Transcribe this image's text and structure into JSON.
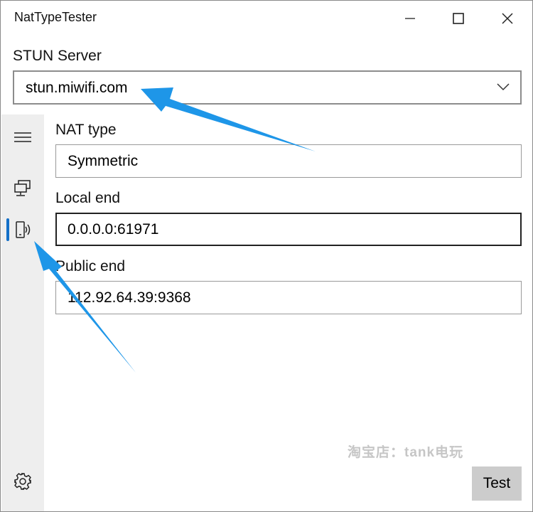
{
  "window": {
    "title": "NatTypeTester"
  },
  "stun": {
    "label": "STUN Server",
    "value": "stun.miwifi.com"
  },
  "nav": {
    "items": [
      {
        "icon": "hamburger-menu-icon",
        "selected": false
      },
      {
        "icon": "computer-network-icon",
        "selected": false
      },
      {
        "icon": "device-signal-icon",
        "selected": true
      },
      {
        "icon": "gear-icon",
        "selected": false
      }
    ],
    "accent_color": "#1470c8"
  },
  "fields": {
    "nat_type": {
      "label": "NAT type",
      "value": "Symmetric"
    },
    "local_end": {
      "label": "Local end",
      "value": "0.0.0.0:61971"
    },
    "public_end": {
      "label": "Public end",
      "value": "112.92.64.39:9368"
    }
  },
  "actions": {
    "test_label": "Test"
  },
  "watermark": {
    "text": "淘宝店：tank电玩"
  },
  "annotation": {
    "arrow_color": "#1e96e8"
  }
}
